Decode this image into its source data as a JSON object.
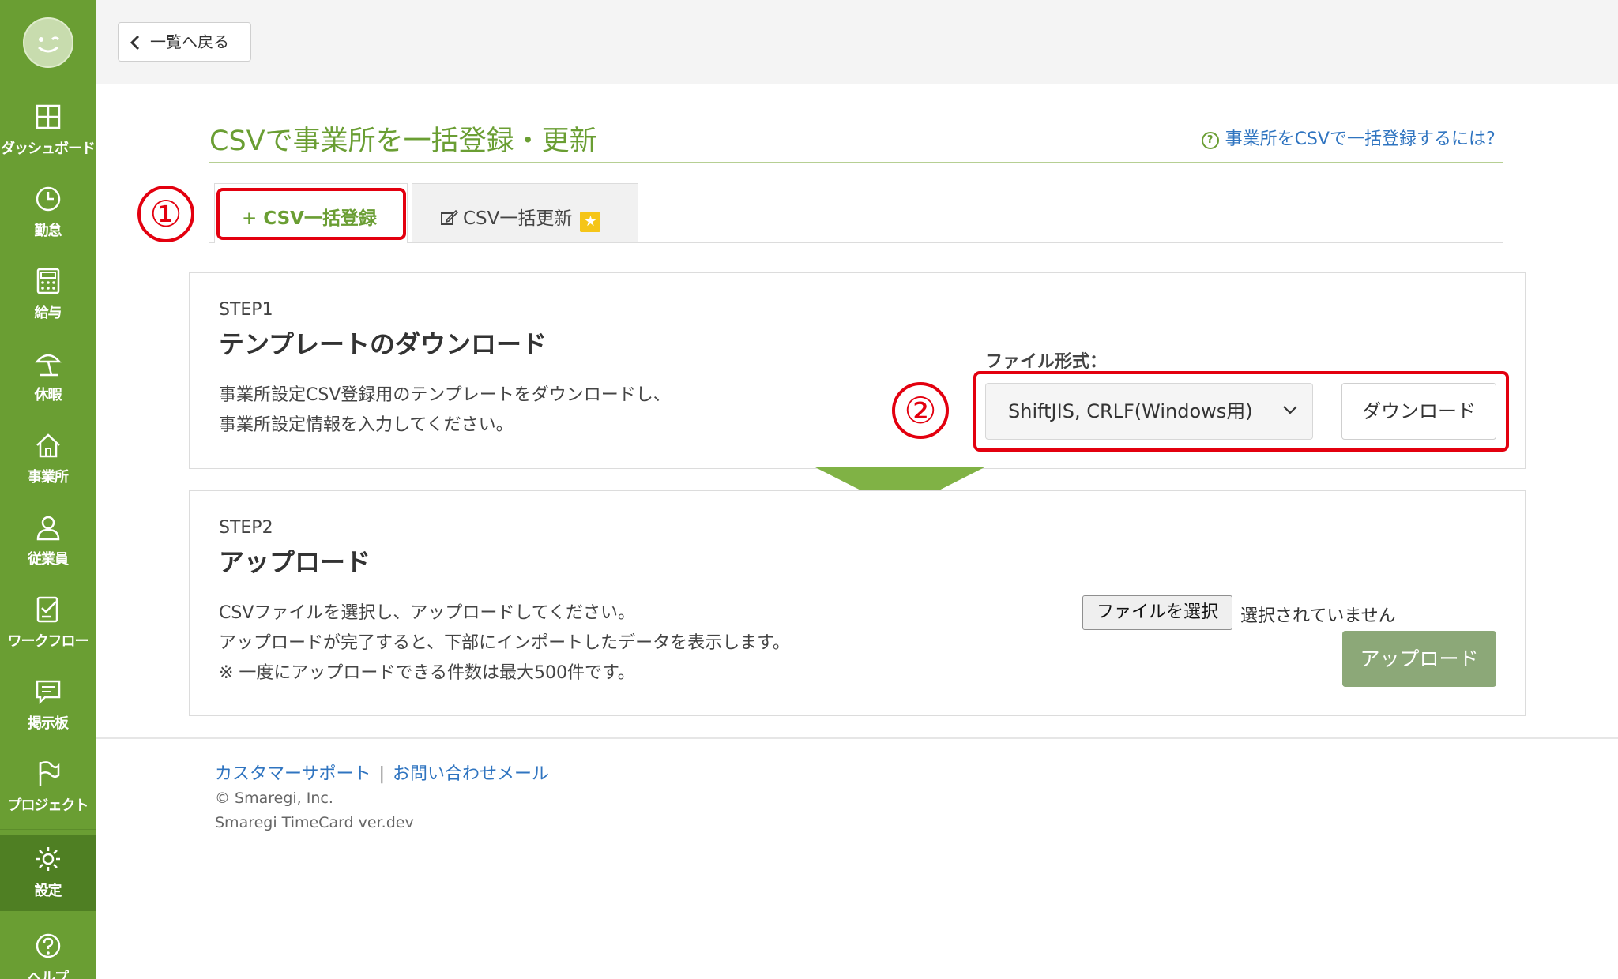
{
  "sidebar": {
    "items": [
      {
        "label": "ダッシュボード",
        "icon": "dashboard-icon"
      },
      {
        "label": "勤怠",
        "icon": "clock-icon"
      },
      {
        "label": "給与",
        "icon": "calculator-icon"
      },
      {
        "label": "休暇",
        "icon": "parasol-icon"
      },
      {
        "label": "事業所",
        "icon": "home-icon"
      },
      {
        "label": "従業員",
        "icon": "person-icon"
      },
      {
        "label": "ワークフロー",
        "icon": "checklist-icon"
      },
      {
        "label": "掲示板",
        "icon": "message-icon"
      },
      {
        "label": "プロジェクト",
        "icon": "flag-icon"
      },
      {
        "label": "設定",
        "icon": "gear-icon"
      },
      {
        "label": "ヘルプ",
        "icon": "help-icon"
      }
    ]
  },
  "header": {
    "back_label": "一覧へ戻る"
  },
  "page": {
    "title": "CSVで事業所を一括登録・更新",
    "help_link": "事業所をCSVで一括登録するには？"
  },
  "tabs": [
    {
      "label": "CSV一括登録",
      "prefix": "+",
      "active": true
    },
    {
      "label": "CSV一括更新",
      "active": false
    }
  ],
  "annotations": {
    "one": "①",
    "two": "②",
    "color": "#e3000f"
  },
  "step1": {
    "tag": "STEP1",
    "title": "テンプレートのダウンロード",
    "desc_line1": "事業所設定CSV登録用のテンプレートをダウンロードし、",
    "desc_line2": "事業所設定情報を入力してください。",
    "format_label": "ファイル形式：",
    "format_value": "ShiftJIS, CRLF(Windows用)",
    "download_label": "ダウンロード"
  },
  "step2": {
    "tag": "STEP2",
    "title": "アップロード",
    "desc_line1": "CSVファイルを選択し、アップロードしてください。",
    "desc_line2": "アップロードが完了すると、下部にインポートしたデータを表示します。",
    "desc_line3": "※ 一度にアップロードできる件数は最大500件です。",
    "file_button": "ファイルを選択",
    "file_status": "選択されていません",
    "upload_label": "アップロード"
  },
  "footer": {
    "support": "カスタマーサポート",
    "separator": "|",
    "contact": "お問い合わせメール",
    "copyright": "© Smaregi, Inc.",
    "version": "Smaregi TimeCard ver.dev"
  },
  "colors": {
    "brand": "#6a9e33",
    "link": "#2f74c0",
    "highlight": "#e3000f"
  }
}
